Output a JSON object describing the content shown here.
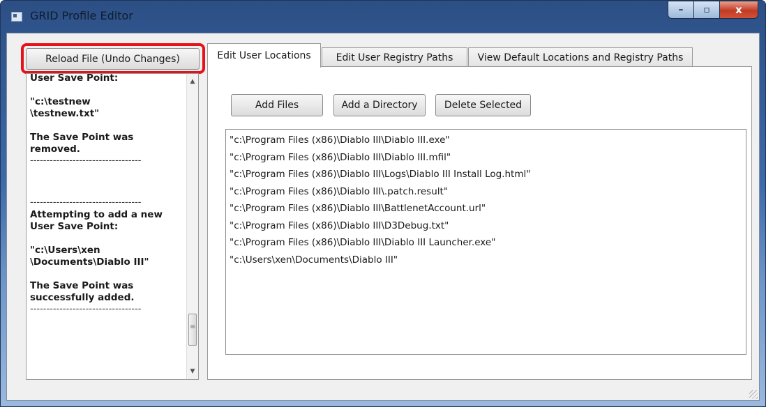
{
  "window": {
    "title": "GRID Profile Editor",
    "icons": {
      "app": "app-icon",
      "minimize": "minimize-icon",
      "maximize": "maximize-icon",
      "close": "close-icon"
    },
    "caption": {
      "minimize": "–",
      "maximize": "▫",
      "close": "x"
    }
  },
  "toolbar": {
    "reload_label": "Reload File (Undo Changes)",
    "highlight_color": "#e8111a"
  },
  "log": {
    "scroll_position_fraction": 0.72,
    "entries": [
      {
        "lines": [
          "User Save Point:"
        ]
      },
      {
        "lines": [
          "\"c:\\testnew",
          "\\testnew.txt\""
        ]
      },
      {
        "lines": [
          "The Save Point was",
          "removed."
        ]
      },
      {
        "divider": "----------------------------------"
      },
      {
        "divider": "----------------------------------"
      },
      {
        "lines": [
          "Attempting to add a new",
          "User Save Point:"
        ]
      },
      {
        "lines": [
          "\"c:\\Users\\xen",
          "\\Documents\\Diablo III\""
        ]
      },
      {
        "lines": [
          "The Save Point was",
          "successfully added."
        ]
      },
      {
        "divider": "----------------------------------"
      }
    ]
  },
  "tabs": [
    {
      "label": "Edit User Locations",
      "active": true
    },
    {
      "label": "Edit User Registry Paths",
      "active": false
    },
    {
      "label": "View Default Locations and Registry Paths",
      "active": false
    }
  ],
  "actions": {
    "add_files": "Add Files",
    "add_directory": "Add a Directory",
    "delete_selected": "Delete Selected"
  },
  "locations": [
    "\"c:\\Program Files (x86)\\Diablo III\\Diablo III.exe\"",
    "\"c:\\Program Files (x86)\\Diablo III\\Diablo III.mfil\"",
    "\"c:\\Program Files (x86)\\Diablo III\\Logs\\Diablo III Install Log.html\"",
    "\"c:\\Program Files (x86)\\Diablo III\\.patch.result\"",
    "\"c:\\Program Files (x86)\\Diablo III\\BattlenetAccount.url\"",
    "\"c:\\Program Files (x86)\\Diablo III\\D3Debug.txt\"",
    "\"c:\\Program Files (x86)\\Diablo III\\Diablo III Launcher.exe\"",
    "\"c:\\Users\\xen\\Documents\\Diablo III\""
  ]
}
